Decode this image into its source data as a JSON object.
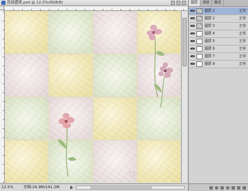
{
  "app": {
    "document_title": "花纹壁纸.psd @ 12.5%(RGB/8)",
    "zoom_level": "12.5%",
    "doc_info": "文档:24.9M/141.2M"
  },
  "layers_panel": {
    "tabs": [
      "图层",
      "通道",
      "路径"
    ],
    "active_tab": 0,
    "layers": [
      {
        "name": "图层 1",
        "mode": "正常",
        "visible": true,
        "selected": true,
        "thumb": "pattern-thumb"
      },
      {
        "name": "图层 2",
        "mode": "正常",
        "visible": true,
        "selected": false,
        "thumb": "pattern-thumb"
      },
      {
        "name": "图层 3",
        "mode": "正常",
        "visible": true,
        "selected": false,
        "thumb": "pattern-thumb"
      },
      {
        "name": "图层 4",
        "mode": "正常",
        "visible": true,
        "selected": false,
        "thumb": "blank-thumb"
      },
      {
        "name": "图层 5",
        "mode": "正常",
        "visible": true,
        "selected": false,
        "thumb": "blank-thumb"
      },
      {
        "name": "图层 6",
        "mode": "正常",
        "visible": true,
        "selected": false,
        "thumb": "blank-thumb"
      },
      {
        "name": "图层 7",
        "mode": "正常",
        "visible": true,
        "selected": false,
        "thumb": "blank-thumb"
      },
      {
        "name": "图层 8",
        "mode": "正常",
        "visible": true,
        "selected": false,
        "thumb": "blank-thumb"
      }
    ]
  },
  "canvas": {
    "tile_colors": [
      "y",
      "g",
      "p",
      "y",
      "p",
      "y",
      "g",
      "p",
      "g",
      "p",
      "y",
      "g",
      "y",
      "g",
      "p",
      "y"
    ],
    "colors": {
      "flower_pink": "#d99aa6",
      "stem_green": "#8fae72",
      "tile_yellow": "#efe6b4",
      "tile_pink": "#ece2e2",
      "tile_green": "#e3ead3"
    }
  }
}
